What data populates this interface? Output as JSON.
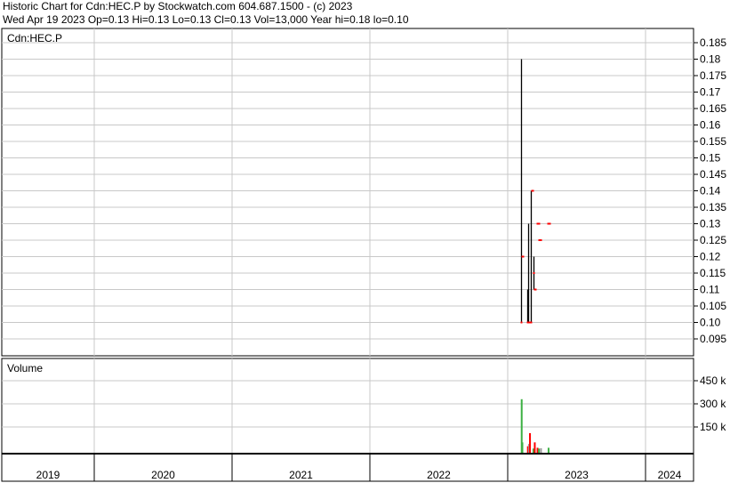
{
  "header": {
    "line1": "Historic Chart for Cdn:HEC.P by Stockwatch.com 604.687.1500 - (c) 2023",
    "line2": "Wed Apr 19 2023   Op=0.13   Hi=0.13   Lo=0.13   Cl=0.13   Vol=13,000   Year hi=0.18   lo=0.10"
  },
  "chart_data": [
    {
      "type": "candlestick",
      "title": "Cdn:HEC.P",
      "ylim": [
        0.09,
        0.187
      ],
      "yticks": [
        "0.185",
        "0.18",
        "0.175",
        "0.17",
        "0.165",
        "0.16",
        "0.155",
        "0.15",
        "0.145",
        "0.14",
        "0.135",
        "0.13",
        "0.125",
        "0.12",
        "0.115",
        "0.11",
        "0.105",
        "0.10",
        "0.095"
      ],
      "xlim": [
        2018.7,
        2024.37
      ],
      "xticks": [
        "2019",
        "2020",
        "2021",
        "2022",
        "2023",
        "2024"
      ],
      "bars": [
        {
          "t": 2023.095,
          "open": 0.1,
          "high": 0.18,
          "low": 0.1,
          "close": 0.12
        },
        {
          "t": 2023.14,
          "open": 0.1,
          "high": 0.11,
          "low": 0.1,
          "close": 0.1
        },
        {
          "t": 2023.15,
          "open": 0.1,
          "high": 0.13,
          "low": 0.1,
          "close": 0.1
        },
        {
          "t": 2023.168,
          "open": 0.1,
          "high": 0.14,
          "low": 0.1,
          "close": 0.14
        },
        {
          "t": 2023.19,
          "open": 0.115,
          "high": 0.12,
          "low": 0.11,
          "close": 0.11
        },
        {
          "t": 2023.21,
          "open": 0.13,
          "high": 0.13,
          "low": 0.13,
          "close": 0.13
        },
        {
          "t": 2023.225,
          "open": 0.125,
          "high": 0.125,
          "low": 0.125,
          "close": 0.125
        },
        {
          "t": 2023.29,
          "open": 0.13,
          "high": 0.13,
          "low": 0.13,
          "close": 0.13
        }
      ]
    },
    {
      "type": "bar",
      "title": "Volume",
      "ylim": [
        0,
        540000
      ],
      "yticks": [
        "450 k",
        "300 k",
        "150 k"
      ],
      "bars": [
        {
          "t": 2023.095,
          "value": 330000,
          "color": "#3cb043"
        },
        {
          "t": 2023.1,
          "value": 50000,
          "color": "#3cb043"
        },
        {
          "t": 2023.14,
          "value": 25000,
          "color": "#ff0000"
        },
        {
          "t": 2023.148,
          "value": 40000,
          "color": "#999999"
        },
        {
          "t": 2023.155,
          "value": 110000,
          "color": "#ff0000"
        },
        {
          "t": 2023.18,
          "value": 10000,
          "color": "#3cb043"
        },
        {
          "t": 2023.19,
          "value": 50000,
          "color": "#ff0000"
        },
        {
          "t": 2023.21,
          "value": 15000,
          "color": "#ff0000"
        },
        {
          "t": 2023.22,
          "value": 10000,
          "color": "#3cb043"
        },
        {
          "t": 2023.235,
          "value": 12000,
          "color": "#999999"
        },
        {
          "t": 2023.29,
          "value": 15000,
          "color": "#3cb043"
        }
      ]
    }
  ],
  "colors": {
    "grid": "#c8c8c8",
    "up": "#000000",
    "mark": "#ff0000"
  }
}
